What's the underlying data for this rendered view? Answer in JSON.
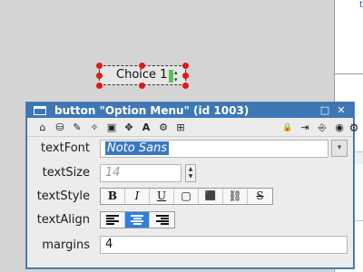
{
  "stage": {
    "button_label": "Choice 1",
    "spin_glyph": "▴▾"
  },
  "background_window": {
    "partial_link_text": "t"
  },
  "palette": {
    "title": "button \"Option Menu\" (id 1003)",
    "titlebar_buttons": {
      "maximize": "□",
      "close": "✕"
    },
    "toolbar_left": [
      {
        "name": "basic-properties-icon",
        "glyph": "⌂"
      },
      {
        "name": "database-icon",
        "glyph": "⛁"
      },
      {
        "name": "pencil-icon",
        "glyph": "✎"
      },
      {
        "name": "magic-wand-icon",
        "glyph": "✧"
      },
      {
        "name": "image-icon",
        "glyph": "▣"
      },
      {
        "name": "move-icon",
        "glyph": "✥"
      },
      {
        "name": "text-icon",
        "glyph": "A"
      },
      {
        "name": "effects-icon",
        "glyph": "⚙"
      },
      {
        "name": "grid-icon",
        "glyph": "⊞"
      }
    ],
    "toolbar_right": [
      {
        "name": "lock-icon",
        "glyph": "🔒"
      },
      {
        "name": "import-icon",
        "glyph": "⇥"
      },
      {
        "name": "export-icon",
        "glyph": "⎆"
      },
      {
        "name": "target-icon",
        "glyph": "◉"
      },
      {
        "name": "gear-icon",
        "glyph": "⚙"
      }
    ],
    "properties": {
      "textFont": {
        "label": "textFont",
        "value": "Noto Sans",
        "dropdown_glyph": "▾"
      },
      "textSize": {
        "label": "textSize",
        "placeholder": "14",
        "stepper_glyph": "▲▼"
      },
      "textStyle": {
        "label": "textStyle",
        "options": [
          {
            "name": "bold-button",
            "glyph": "B"
          },
          {
            "name": "italic-button",
            "glyph": "I"
          },
          {
            "name": "underline-button",
            "glyph": "U"
          },
          {
            "name": "box-button",
            "glyph": "▢"
          },
          {
            "name": "threed-box-button",
            "glyph": "⬛"
          },
          {
            "name": "link-button",
            "glyph": "⛓"
          },
          {
            "name": "strikeout-button",
            "glyph": "S"
          }
        ]
      },
      "textAlign": {
        "label": "textAlign",
        "options": [
          "left",
          "center",
          "right"
        ],
        "selected": "center"
      },
      "margins": {
        "label": "margins",
        "value": "4"
      }
    }
  },
  "colors": {
    "titlebar": "#3e77b5",
    "selection": "#3b78c4",
    "active_toggle": "#2f7fe0",
    "handles": "#e01818"
  }
}
